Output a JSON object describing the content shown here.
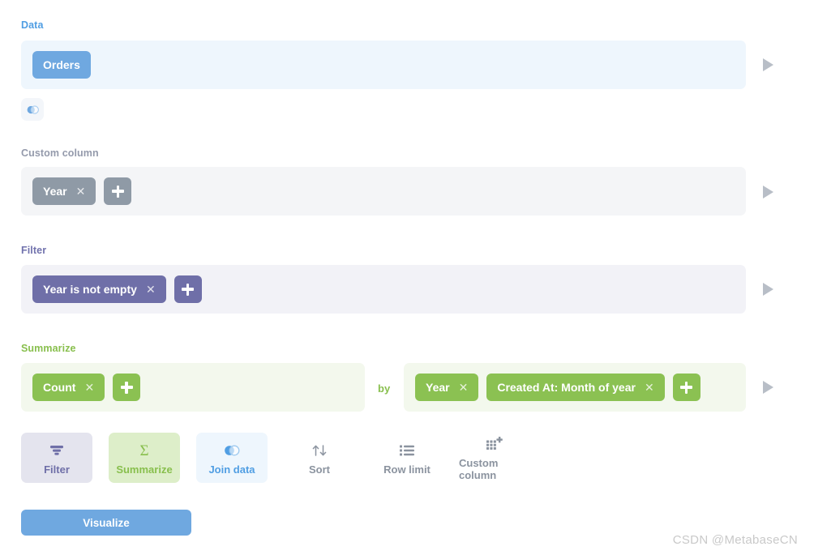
{
  "sections": {
    "data": {
      "label": "Data",
      "table_chip": "Orders",
      "join_icon": "venn-join-icon",
      "preview_icon": "play-triangle-icon"
    },
    "custom_column": {
      "label": "Custom column",
      "chips": [
        {
          "label": "Year",
          "remove": "✕"
        }
      ],
      "add_label": "+",
      "preview_icon": "play-triangle-icon"
    },
    "filter": {
      "label": "Filter",
      "chips": [
        {
          "label": "Year is not empty",
          "remove": "✕"
        }
      ],
      "add_label": "+",
      "preview_icon": "play-triangle-icon"
    },
    "summarize": {
      "label": "Summarize",
      "aggregations": [
        {
          "label": "Count",
          "remove": "✕"
        }
      ],
      "aggregation_add_label": "+",
      "by_word": "by",
      "breakouts": [
        {
          "label": "Year",
          "remove": "✕"
        },
        {
          "label": "Created At: Month of year",
          "remove": "✕"
        }
      ],
      "breakout_add_label": "+",
      "preview_icon": "play-triangle-icon"
    }
  },
  "actions": [
    {
      "label": "Filter",
      "icon": "funnel-icon"
    },
    {
      "label": "Summarize",
      "icon": "sigma-icon"
    },
    {
      "label": "Join data",
      "icon": "venn-join-icon"
    },
    {
      "label": "Sort",
      "icon": "sort-arrows-icon"
    },
    {
      "label": "Row limit",
      "icon": "list-icon"
    },
    {
      "label": "Custom column",
      "icon": "grid-plus-icon"
    }
  ],
  "visualize_button": "Visualize",
  "watermark": "CSDN @MetabaseCN",
  "colors": {
    "brand_blue": "#509ee3",
    "chip_blue": "#6fa8e0",
    "gray": "#8f9aa6",
    "purple": "#6f6fa8",
    "green": "#88bf4d",
    "chip_green": "#8bc152"
  }
}
